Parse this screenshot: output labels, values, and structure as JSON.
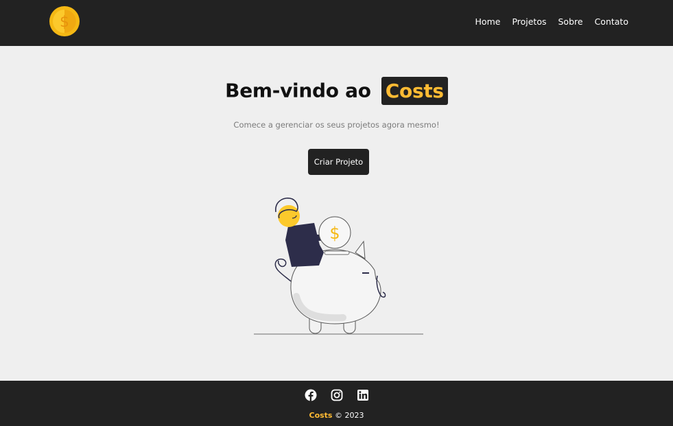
{
  "navbar": {
    "logo": "coin-dollar-icon",
    "links": [
      {
        "label": "Home"
      },
      {
        "label": "Projetos"
      },
      {
        "label": "Sobre"
      },
      {
        "label": "Contato"
      }
    ]
  },
  "hero": {
    "title_prefix": "Bem-vindo ao",
    "title_brand": "Costs",
    "subtitle": "Comece a gerenciar os seus projetos agora mesmo!",
    "cta_label": "Criar Projeto",
    "illustration": "person-with-piggy-bank-illustration"
  },
  "footer": {
    "social": [
      "facebook-icon",
      "instagram-icon",
      "linkedin-icon"
    ],
    "brand": "Costs",
    "copyright": "© 2023"
  },
  "colors": {
    "dark": "#222222",
    "accent": "#ffbb33",
    "background": "#efefef"
  }
}
